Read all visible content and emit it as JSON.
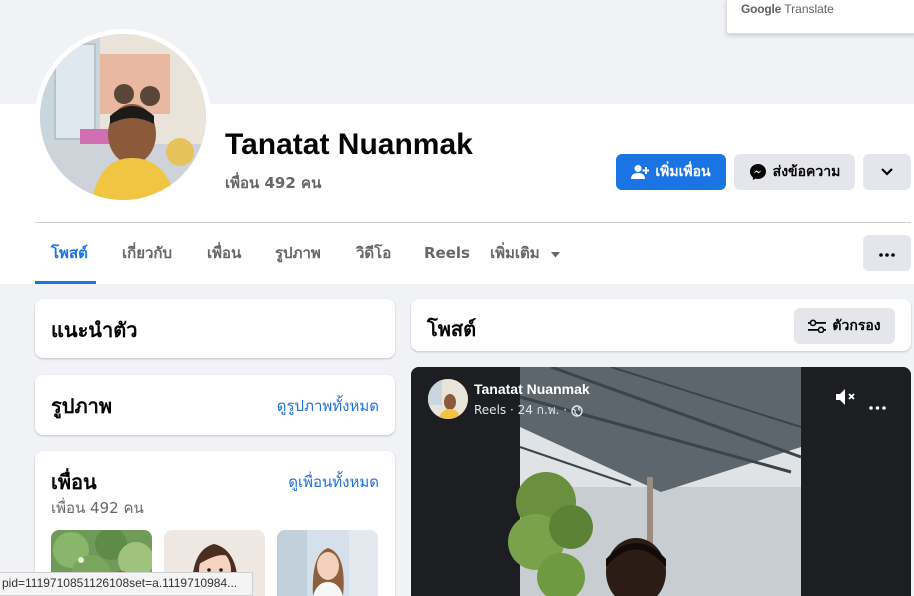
{
  "google_translate": {
    "brand": "Google",
    "label": "Translate"
  },
  "profile": {
    "name": "Tanatat Nuanmak",
    "friends_count": "เพื่อน 492 คน"
  },
  "actions": {
    "add_friend": "เพิ่มเพื่อน",
    "message": "ส่งข้อความ"
  },
  "tabs": [
    {
      "label": "โพสต์"
    },
    {
      "label": "เกี่ยวกับ"
    },
    {
      "label": "เพื่อน"
    },
    {
      "label": "รูปภาพ"
    },
    {
      "label": "วิดีโอ"
    },
    {
      "label": "Reels"
    },
    {
      "label": "เพิ่มเติม"
    }
  ],
  "intro": {
    "title": "แนะนำตัว"
  },
  "photos": {
    "title": "รูปภาพ",
    "see_all": "ดูรูปภาพทั้งหมด"
  },
  "friends": {
    "title": "เพื่อน",
    "see_all": "ดูเพื่อนทั้งหมด",
    "count": "เพื่อน 492 คน"
  },
  "posts": {
    "title": "โพสต์",
    "filter_label": "ตัวกรอง"
  },
  "post": {
    "author": "Tanatat Nuanmak",
    "meta": "Reels · 24 ก.พ. ·"
  },
  "status_bar": {
    "text": "pid=1119710851126108set=a.1119710984..."
  },
  "colors": {
    "accent": "#1b74e4",
    "link": "#216fdb",
    "muted": "#65676b"
  },
  "icons": [
    "add-friend-icon",
    "messenger-icon",
    "chevron-down-icon",
    "more-dots-icon",
    "filter-icon",
    "mute-icon",
    "globe-icon",
    "caret-down-icon"
  ]
}
